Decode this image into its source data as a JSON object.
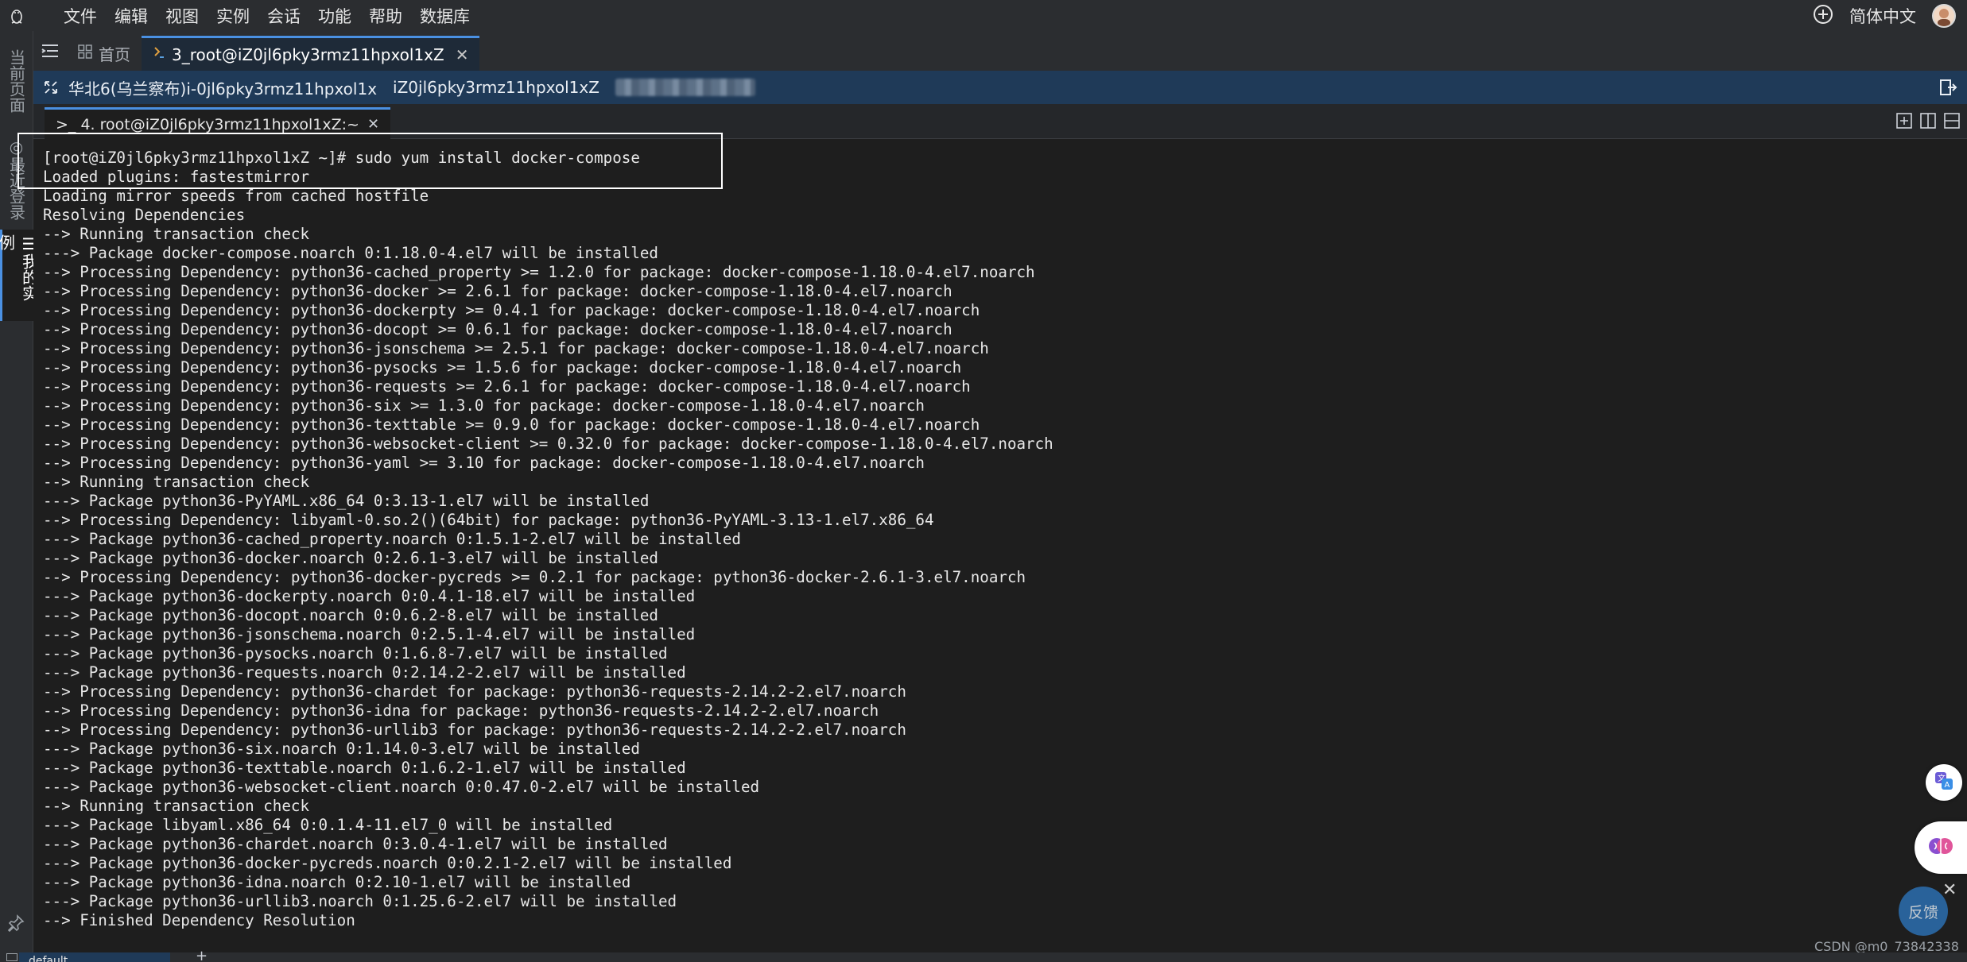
{
  "menu": {
    "items": [
      "文件",
      "编辑",
      "视图",
      "实例",
      "会话",
      "功能",
      "帮助",
      "数据库"
    ],
    "language": "简体中文"
  },
  "sidebar": {
    "items": [
      {
        "label": "当前页面",
        "active": false
      },
      {
        "label": "◎最近登录",
        "active": false
      },
      {
        "label": "☰我的实例",
        "active": true
      }
    ]
  },
  "tabs": [
    {
      "label": "首页",
      "icon": "grid-icon",
      "active": false
    },
    {
      "label": "3_root@iZ0jl6pky3rmz11hpxol1xZ",
      "icon": "terminal-icon",
      "active": true,
      "closable": true
    }
  ],
  "hostbar": {
    "region": "华北6(乌兰察布)i-0jl6pky3rmz11hpxol1x",
    "hostname": "iZ0jl6pky3rmz11hpxol1xZ"
  },
  "terminal_tab": {
    "label": ">_ 4. root@iZ0jl6pky3rmz11hpxol1xZ:~"
  },
  "terminal": {
    "lines": [
      "[root@iZ0jl6pky3rmz11hpxol1xZ ~]# sudo yum install docker-compose",
      "Loaded plugins: fastestmirror",
      "Loading mirror speeds from cached hostfile",
      "Resolving Dependencies",
      "--> Running transaction check",
      "---> Package docker-compose.noarch 0:1.18.0-4.el7 will be installed",
      "--> Processing Dependency: python36-cached_property >= 1.2.0 for package: docker-compose-1.18.0-4.el7.noarch",
      "--> Processing Dependency: python36-docker >= 2.6.1 for package: docker-compose-1.18.0-4.el7.noarch",
      "--> Processing Dependency: python36-dockerpty >= 0.4.1 for package: docker-compose-1.18.0-4.el7.noarch",
      "--> Processing Dependency: python36-docopt >= 0.6.1 for package: docker-compose-1.18.0-4.el7.noarch",
      "--> Processing Dependency: python36-jsonschema >= 2.5.1 for package: docker-compose-1.18.0-4.el7.noarch",
      "--> Processing Dependency: python36-pysocks >= 1.5.6 for package: docker-compose-1.18.0-4.el7.noarch",
      "--> Processing Dependency: python36-requests >= 2.6.1 for package: docker-compose-1.18.0-4.el7.noarch",
      "--> Processing Dependency: python36-six >= 1.3.0 for package: docker-compose-1.18.0-4.el7.noarch",
      "--> Processing Dependency: python36-texttable >= 0.9.0 for package: docker-compose-1.18.0-4.el7.noarch",
      "--> Processing Dependency: python36-websocket-client >= 0.32.0 for package: docker-compose-1.18.0-4.el7.noarch",
      "--> Processing Dependency: python36-yaml >= 3.10 for package: docker-compose-1.18.0-4.el7.noarch",
      "--> Running transaction check",
      "---> Package python36-PyYAML.x86_64 0:3.13-1.el7 will be installed",
      "--> Processing Dependency: libyaml-0.so.2()(64bit) for package: python36-PyYAML-3.13-1.el7.x86_64",
      "---> Package python36-cached_property.noarch 0:1.5.1-2.el7 will be installed",
      "---> Package python36-docker.noarch 0:2.6.1-3.el7 will be installed",
      "--> Processing Dependency: python36-docker-pycreds >= 0.2.1 for package: python36-docker-2.6.1-3.el7.noarch",
      "---> Package python36-dockerpty.noarch 0:0.4.1-18.el7 will be installed",
      "---> Package python36-docopt.noarch 0:0.6.2-8.el7 will be installed",
      "---> Package python36-jsonschema.noarch 0:2.5.1-4.el7 will be installed",
      "---> Package python36-pysocks.noarch 0:1.6.8-7.el7 will be installed",
      "---> Package python36-requests.noarch 0:2.14.2-2.el7 will be installed",
      "--> Processing Dependency: python36-chardet for package: python36-requests-2.14.2-2.el7.noarch",
      "--> Processing Dependency: python36-idna for package: python36-requests-2.14.2-2.el7.noarch",
      "--> Processing Dependency: python36-urllib3 for package: python36-requests-2.14.2-2.el7.noarch",
      "---> Package python36-six.noarch 0:1.14.0-3.el7 will be installed",
      "---> Package python36-texttable.noarch 0:1.6.2-1.el7 will be installed",
      "---> Package python36-websocket-client.noarch 0:0.47.0-2.el7 will be installed",
      "--> Running transaction check",
      "---> Package libyaml.x86_64 0:0.1.4-11.el7_0 will be installed",
      "---> Package python36-chardet.noarch 0:3.0.4-1.el7 will be installed",
      "---> Package python36-docker-pycreds.noarch 0:0.2.1-2.el7 will be installed",
      "---> Package python36-idna.noarch 0:2.10-1.el7 will be installed",
      "---> Package python36-urllib3.noarch 0:1.25.6-2.el7 will be installed",
      "--> Finished Dependency Resolution"
    ]
  },
  "widgets": {
    "feedback_label": "反馈",
    "watermark": "CSDN @m0_73842338"
  },
  "statusbar": {
    "tab_label": "default",
    "add_label": "+"
  },
  "colors": {
    "accent": "#4a90e2",
    "hostbar": "#1f3a58",
    "terminal_bg": "#1e1e1e"
  }
}
